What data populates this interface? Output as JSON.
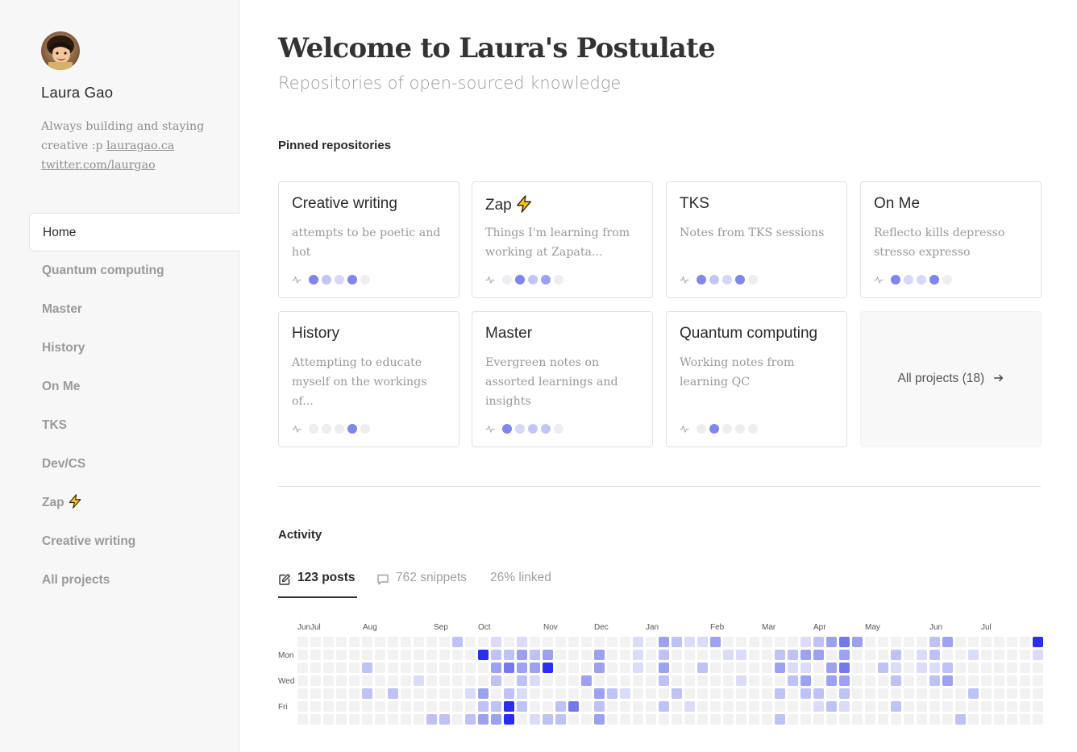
{
  "profile": {
    "name": "Laura Gao",
    "bio_prefix": "Always building and staying creative :p ",
    "link1": "lauragao.ca",
    "link2": "twitter.com/laurgao"
  },
  "nav": {
    "items": [
      {
        "label": "Home",
        "active": true
      },
      {
        "label": "Quantum computing"
      },
      {
        "label": "Master"
      },
      {
        "label": "History"
      },
      {
        "label": "On Me"
      },
      {
        "label": "TKS"
      },
      {
        "label": "Dev/CS"
      },
      {
        "label": "Zap",
        "icon": "lightning-icon"
      },
      {
        "label": "Creative writing"
      },
      {
        "label": "All projects"
      }
    ]
  },
  "header": {
    "title": "Welcome to Laura's Postulate",
    "subtitle": "Repositories of open-sourced knowledge"
  },
  "pinned": {
    "heading": "Pinned repositories",
    "cards": [
      {
        "title": "Creative writing",
        "desc": "attempts to be poetic and hot",
        "activity": [
          4,
          2,
          1,
          4,
          0
        ]
      },
      {
        "title": "Zap",
        "icon": "lightning-icon",
        "desc": "Things I'm learning from working at Zapata...",
        "activity": [
          0,
          4,
          2,
          3,
          0
        ]
      },
      {
        "title": "TKS",
        "desc": "Notes from TKS sessions",
        "activity": [
          4,
          2,
          1,
          4,
          0
        ]
      },
      {
        "title": "On Me",
        "desc": "Reflecto kills depresso stresso expresso",
        "activity": [
          4,
          1,
          1,
          4,
          0
        ]
      },
      {
        "title": "History",
        "desc": "Attempting to educate myself on the workings of...",
        "activity": [
          0,
          0,
          0,
          4,
          0
        ]
      },
      {
        "title": "Master",
        "desc": "Evergreen notes on assorted learnings and insights",
        "activity": [
          4,
          1,
          2,
          2,
          0
        ]
      },
      {
        "title": "Quantum computing",
        "desc": "Working notes from learning QC",
        "activity": [
          0,
          4,
          0,
          0,
          0
        ]
      }
    ],
    "all_label": "All projects (18)"
  },
  "activity": {
    "heading": "Activity",
    "tabs": [
      {
        "count": "123",
        "label": "posts",
        "icon": "edit-icon",
        "active": true
      },
      {
        "count": "762",
        "label": "snippets",
        "icon": "comment-icon"
      },
      {
        "count": "26%",
        "label": "linked"
      }
    ],
    "months": [
      "Jun",
      "Jul",
      "Aug",
      "Sep",
      "Oct",
      "Nov",
      "Dec",
      "Jan",
      "Feb",
      "Mar",
      "Apr",
      "May",
      "Jun",
      "Jul"
    ],
    "day_labels": [
      "Mon",
      "Wed",
      "Fri"
    ],
    "levels_by_week": [
      [
        0,
        0,
        0,
        0,
        0,
        0,
        0
      ],
      [
        0,
        0,
        0,
        0,
        0,
        0,
        0
      ],
      [
        0,
        0,
        0,
        0,
        0,
        0,
        0
      ],
      [
        0,
        0,
        0,
        0,
        0,
        0,
        0
      ],
      [
        0,
        0,
        0,
        0,
        0,
        0,
        0
      ],
      [
        0,
        0,
        2,
        0,
        2,
        0,
        0
      ],
      [
        0,
        0,
        0,
        0,
        0,
        0,
        0
      ],
      [
        0,
        0,
        0,
        0,
        2,
        0,
        0
      ],
      [
        0,
        0,
        0,
        0,
        0,
        0,
        0
      ],
      [
        0,
        0,
        0,
        1,
        0,
        0,
        0
      ],
      [
        0,
        0,
        0,
        0,
        0,
        0,
        2
      ],
      [
        0,
        0,
        0,
        0,
        0,
        0,
        2
      ],
      [
        2,
        0,
        0,
        0,
        0,
        0,
        0
      ],
      [
        0,
        0,
        0,
        0,
        1,
        0,
        2
      ],
      [
        0,
        5,
        0,
        0,
        3,
        2,
        3
      ],
      [
        1,
        2,
        3,
        2,
        0,
        2,
        3
      ],
      [
        0,
        2,
        4,
        0,
        2,
        5,
        5
      ],
      [
        1,
        3,
        3,
        2,
        1,
        2,
        0
      ],
      [
        0,
        2,
        3,
        1,
        0,
        0,
        1
      ],
      [
        0,
        3,
        5,
        0,
        0,
        0,
        2
      ],
      [
        0,
        0,
        0,
        0,
        0,
        2,
        2
      ],
      [
        0,
        0,
        0,
        0,
        0,
        4,
        0
      ],
      [
        0,
        0,
        0,
        3,
        0,
        0,
        0
      ],
      [
        0,
        3,
        3,
        0,
        3,
        2,
        3
      ],
      [
        0,
        0,
        0,
        0,
        2,
        0,
        0
      ],
      [
        0,
        0,
        0,
        0,
        1,
        0,
        0
      ],
      [
        1,
        1,
        1,
        0,
        0,
        0,
        0
      ],
      [
        0,
        0,
        0,
        0,
        0,
        0,
        0
      ],
      [
        3,
        2,
        3,
        2,
        0,
        2,
        0
      ],
      [
        2,
        0,
        0,
        0,
        2,
        0,
        0
      ],
      [
        1,
        0,
        0,
        0,
        0,
        1,
        0
      ],
      [
        1,
        0,
        2,
        0,
        0,
        0,
        0
      ],
      [
        3,
        0,
        0,
        0,
        0,
        0,
        0
      ],
      [
        0,
        1,
        0,
        0,
        0,
        0,
        0
      ],
      [
        0,
        1,
        0,
        1,
        0,
        0,
        0
      ],
      [
        0,
        0,
        0,
        0,
        0,
        0,
        0
      ],
      [
        0,
        0,
        0,
        0,
        0,
        0,
        0
      ],
      [
        0,
        2,
        3,
        0,
        2,
        0,
        2
      ],
      [
        0,
        2,
        1,
        2,
        0,
        0,
        0
      ],
      [
        1,
        3,
        1,
        3,
        2,
        0,
        0
      ],
      [
        2,
        3,
        0,
        0,
        2,
        1,
        0
      ],
      [
        3,
        0,
        3,
        3,
        0,
        2,
        0
      ],
      [
        4,
        3,
        4,
        3,
        2,
        1,
        0
      ],
      [
        3,
        0,
        0,
        0,
        0,
        0,
        0
      ],
      [
        0,
        0,
        0,
        0,
        0,
        0,
        0
      ],
      [
        0,
        0,
        2,
        0,
        0,
        0,
        0
      ],
      [
        0,
        2,
        1,
        2,
        0,
        2,
        0
      ],
      [
        0,
        0,
        0,
        0,
        0,
        0,
        0
      ],
      [
        0,
        1,
        1,
        0,
        0,
        0,
        0
      ],
      [
        2,
        2,
        1,
        2,
        0,
        0,
        0
      ],
      [
        3,
        0,
        2,
        3,
        0,
        0,
        0
      ],
      [
        0,
        0,
        0,
        0,
        0,
        0,
        2
      ],
      [
        0,
        1,
        0,
        0,
        2,
        0,
        0
      ],
      [
        0,
        0,
        0,
        0,
        0,
        0,
        0
      ],
      [
        0,
        0,
        0,
        0,
        0,
        0,
        0
      ],
      [
        0,
        0,
        0,
        0,
        0,
        0,
        0
      ],
      [
        0,
        0,
        0,
        0,
        0,
        0,
        0
      ],
      [
        5,
        1,
        0,
        0,
        0,
        0,
        0
      ]
    ]
  },
  "colors": {
    "accent": "#2b2ef0",
    "level1": "#dadcf8",
    "level2": "#bfc2f4",
    "level3": "#9da2f0",
    "level4": "#7479ea",
    "level5": "#2b2ef0",
    "empty": "#f2f2f2"
  }
}
